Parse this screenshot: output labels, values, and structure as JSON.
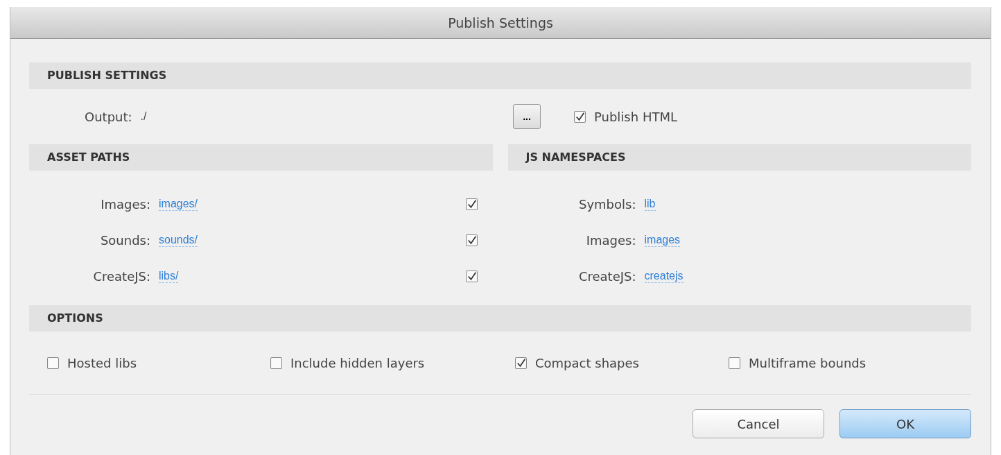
{
  "window": {
    "title": "Publish Settings"
  },
  "publish_settings": {
    "heading": "PUBLISH SETTINGS",
    "output_label": "Output:",
    "output_value": "./",
    "browse_button": "...",
    "publish_html": {
      "label": "Publish HTML",
      "checked": true
    }
  },
  "asset_paths": {
    "heading": "ASSET PATHS",
    "rows": [
      {
        "label": "Images:",
        "value": "images/",
        "checked": true
      },
      {
        "label": "Sounds:",
        "value": "sounds/",
        "checked": true
      },
      {
        "label": "CreateJS:",
        "value": "libs/",
        "checked": true
      }
    ]
  },
  "js_namespaces": {
    "heading": "JS NAMESPACES",
    "rows": [
      {
        "label": "Symbols:",
        "value": "lib"
      },
      {
        "label": "Images:",
        "value": "images"
      },
      {
        "label": "CreateJS:",
        "value": "createjs"
      }
    ]
  },
  "options": {
    "heading": "OPTIONS",
    "items": [
      {
        "label": "Hosted libs",
        "checked": false
      },
      {
        "label": "Include hidden layers",
        "checked": false
      },
      {
        "label": "Compact shapes",
        "checked": true
      },
      {
        "label": "Multiframe bounds",
        "checked": false
      }
    ]
  },
  "buttons": [
    {
      "label": "Cancel",
      "kind": "normal"
    },
    {
      "label": "OK",
      "kind": "default"
    }
  ]
}
